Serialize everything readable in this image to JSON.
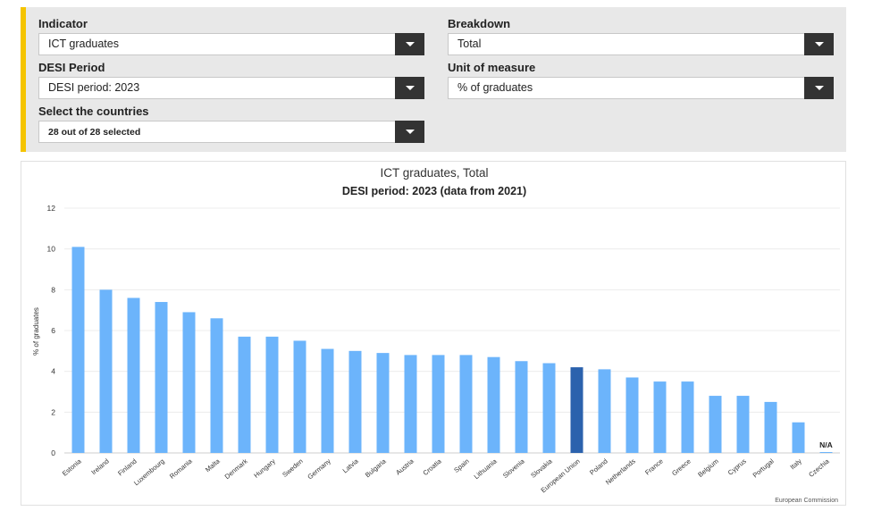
{
  "filters": {
    "indicator": {
      "label": "Indicator",
      "value": "ICT graduates"
    },
    "breakdown": {
      "label": "Breakdown",
      "value": "Total"
    },
    "period": {
      "label": "DESI Period",
      "value": "DESI period: 2023"
    },
    "unit": {
      "label": "Unit of measure",
      "value": "% of graduates"
    },
    "countries": {
      "label": "Select the countries",
      "value": "28 out of 28 selected"
    }
  },
  "colors": {
    "bar": "#6cb4fb",
    "highlight": "#2b62ad",
    "accent": "#f5c400"
  },
  "icons": {
    "dropdown": "chevron-down-icon"
  },
  "credit": "European Commission",
  "chart_data": {
    "type": "bar",
    "title": "ICT graduates, Total",
    "subtitle": "DESI period: 2023 (data from 2021)",
    "xlabel": "",
    "ylabel": "% of graduates",
    "ylim": [
      0,
      12
    ],
    "yticks": [
      0,
      2,
      4,
      6,
      8,
      10,
      12
    ],
    "grid": true,
    "highlight_category": "European Union",
    "na_label": "N/A",
    "categories": [
      "Estonia",
      "Ireland",
      "Finland",
      "Luxembourg",
      "Romania",
      "Malta",
      "Denmark",
      "Hungary",
      "Sweden",
      "Germany",
      "Latvia",
      "Bulgaria",
      "Austria",
      "Croatia",
      "Spain",
      "Lithuania",
      "Slovenia",
      "Slovakia",
      "European Union",
      "Poland",
      "Netherlands",
      "France",
      "Greece",
      "Belgium",
      "Cyprus",
      "Portugal",
      "Italy",
      "Czechia"
    ],
    "values": [
      10.1,
      8.0,
      7.6,
      7.4,
      6.9,
      6.6,
      5.7,
      5.7,
      5.5,
      5.1,
      5.0,
      4.9,
      4.8,
      4.8,
      4.8,
      4.7,
      4.5,
      4.4,
      4.2,
      4.1,
      3.7,
      3.5,
      3.5,
      2.8,
      2.8,
      2.5,
      1.5,
      null
    ]
  }
}
